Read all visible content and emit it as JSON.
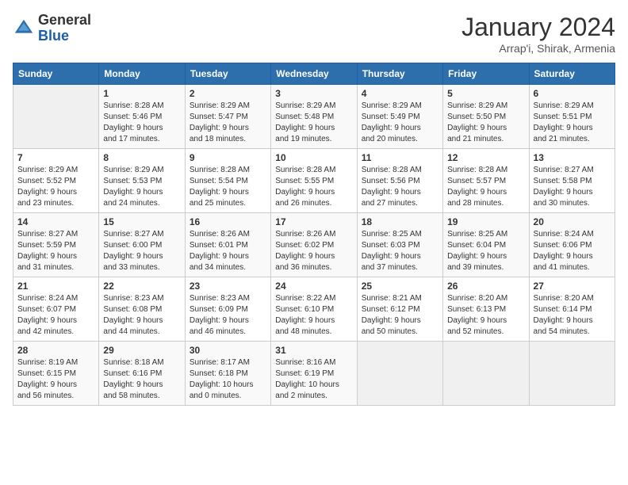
{
  "header": {
    "logo_general": "General",
    "logo_blue": "Blue",
    "month_year": "January 2024",
    "location": "Arrap'i, Shirak, Armenia"
  },
  "weekdays": [
    "Sunday",
    "Monday",
    "Tuesday",
    "Wednesday",
    "Thursday",
    "Friday",
    "Saturday"
  ],
  "weeks": [
    [
      {
        "day": "",
        "info": ""
      },
      {
        "day": "1",
        "info": "Sunrise: 8:28 AM\nSunset: 5:46 PM\nDaylight: 9 hours\nand 17 minutes."
      },
      {
        "day": "2",
        "info": "Sunrise: 8:29 AM\nSunset: 5:47 PM\nDaylight: 9 hours\nand 18 minutes."
      },
      {
        "day": "3",
        "info": "Sunrise: 8:29 AM\nSunset: 5:48 PM\nDaylight: 9 hours\nand 19 minutes."
      },
      {
        "day": "4",
        "info": "Sunrise: 8:29 AM\nSunset: 5:49 PM\nDaylight: 9 hours\nand 20 minutes."
      },
      {
        "day": "5",
        "info": "Sunrise: 8:29 AM\nSunset: 5:50 PM\nDaylight: 9 hours\nand 21 minutes."
      },
      {
        "day": "6",
        "info": "Sunrise: 8:29 AM\nSunset: 5:51 PM\nDaylight: 9 hours\nand 21 minutes."
      }
    ],
    [
      {
        "day": "7",
        "info": "Sunrise: 8:29 AM\nSunset: 5:52 PM\nDaylight: 9 hours\nand 23 minutes."
      },
      {
        "day": "8",
        "info": "Sunrise: 8:29 AM\nSunset: 5:53 PM\nDaylight: 9 hours\nand 24 minutes."
      },
      {
        "day": "9",
        "info": "Sunrise: 8:28 AM\nSunset: 5:54 PM\nDaylight: 9 hours\nand 25 minutes."
      },
      {
        "day": "10",
        "info": "Sunrise: 8:28 AM\nSunset: 5:55 PM\nDaylight: 9 hours\nand 26 minutes."
      },
      {
        "day": "11",
        "info": "Sunrise: 8:28 AM\nSunset: 5:56 PM\nDaylight: 9 hours\nand 27 minutes."
      },
      {
        "day": "12",
        "info": "Sunrise: 8:28 AM\nSunset: 5:57 PM\nDaylight: 9 hours\nand 28 minutes."
      },
      {
        "day": "13",
        "info": "Sunrise: 8:27 AM\nSunset: 5:58 PM\nDaylight: 9 hours\nand 30 minutes."
      }
    ],
    [
      {
        "day": "14",
        "info": "Sunrise: 8:27 AM\nSunset: 5:59 PM\nDaylight: 9 hours\nand 31 minutes."
      },
      {
        "day": "15",
        "info": "Sunrise: 8:27 AM\nSunset: 6:00 PM\nDaylight: 9 hours\nand 33 minutes."
      },
      {
        "day": "16",
        "info": "Sunrise: 8:26 AM\nSunset: 6:01 PM\nDaylight: 9 hours\nand 34 minutes."
      },
      {
        "day": "17",
        "info": "Sunrise: 8:26 AM\nSunset: 6:02 PM\nDaylight: 9 hours\nand 36 minutes."
      },
      {
        "day": "18",
        "info": "Sunrise: 8:25 AM\nSunset: 6:03 PM\nDaylight: 9 hours\nand 37 minutes."
      },
      {
        "day": "19",
        "info": "Sunrise: 8:25 AM\nSunset: 6:04 PM\nDaylight: 9 hours\nand 39 minutes."
      },
      {
        "day": "20",
        "info": "Sunrise: 8:24 AM\nSunset: 6:06 PM\nDaylight: 9 hours\nand 41 minutes."
      }
    ],
    [
      {
        "day": "21",
        "info": "Sunrise: 8:24 AM\nSunset: 6:07 PM\nDaylight: 9 hours\nand 42 minutes."
      },
      {
        "day": "22",
        "info": "Sunrise: 8:23 AM\nSunset: 6:08 PM\nDaylight: 9 hours\nand 44 minutes."
      },
      {
        "day": "23",
        "info": "Sunrise: 8:23 AM\nSunset: 6:09 PM\nDaylight: 9 hours\nand 46 minutes."
      },
      {
        "day": "24",
        "info": "Sunrise: 8:22 AM\nSunset: 6:10 PM\nDaylight: 9 hours\nand 48 minutes."
      },
      {
        "day": "25",
        "info": "Sunrise: 8:21 AM\nSunset: 6:12 PM\nDaylight: 9 hours\nand 50 minutes."
      },
      {
        "day": "26",
        "info": "Sunrise: 8:20 AM\nSunset: 6:13 PM\nDaylight: 9 hours\nand 52 minutes."
      },
      {
        "day": "27",
        "info": "Sunrise: 8:20 AM\nSunset: 6:14 PM\nDaylight: 9 hours\nand 54 minutes."
      }
    ],
    [
      {
        "day": "28",
        "info": "Sunrise: 8:19 AM\nSunset: 6:15 PM\nDaylight: 9 hours\nand 56 minutes."
      },
      {
        "day": "29",
        "info": "Sunrise: 8:18 AM\nSunset: 6:16 PM\nDaylight: 9 hours\nand 58 minutes."
      },
      {
        "day": "30",
        "info": "Sunrise: 8:17 AM\nSunset: 6:18 PM\nDaylight: 10 hours\nand 0 minutes."
      },
      {
        "day": "31",
        "info": "Sunrise: 8:16 AM\nSunset: 6:19 PM\nDaylight: 10 hours\nand 2 minutes."
      },
      {
        "day": "",
        "info": ""
      },
      {
        "day": "",
        "info": ""
      },
      {
        "day": "",
        "info": ""
      }
    ]
  ]
}
